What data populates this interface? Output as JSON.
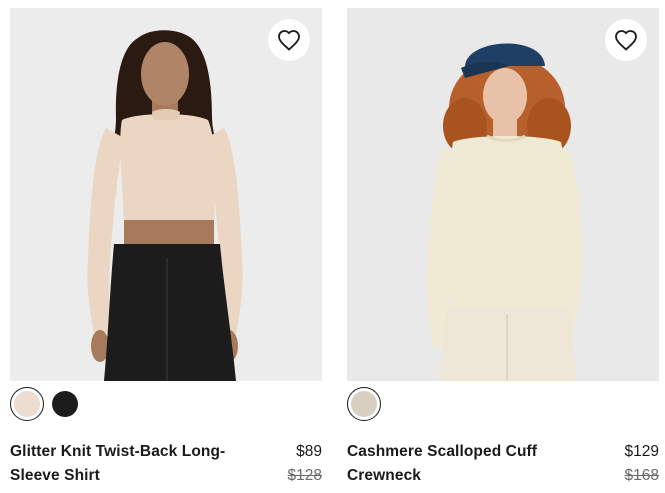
{
  "products": [
    {
      "title": "Glitter Knit Twist-Back Long-Sleeve Shirt",
      "price_now": "$89",
      "price_was": "$128",
      "wishlist_icon": "heart-outline-icon",
      "swatches": [
        {
          "color": "#eddcd0",
          "selected": true
        },
        {
          "color": "#1c1c1c",
          "selected": false
        }
      ],
      "colors": {
        "image_bg": "#ececec",
        "top": "#ead6c2",
        "pants": "#1c1c1c",
        "skin": "#a87a5c",
        "hair": "#2b1a12"
      }
    },
    {
      "title": "Cashmere Scalloped Cuff Crewneck",
      "price_now": "$129",
      "price_was": "$168",
      "wishlist_icon": "heart-outline-icon",
      "swatches": [
        {
          "color": "#d9cfc1",
          "selected": true
        }
      ],
      "colors": {
        "image_bg": "#e9e9ea",
        "top": "#f0e9d4",
        "pants": "#eee6d6",
        "skin": "#e8c2a8",
        "hair": "#b8602c",
        "cap": "#1f3e63"
      }
    }
  ]
}
